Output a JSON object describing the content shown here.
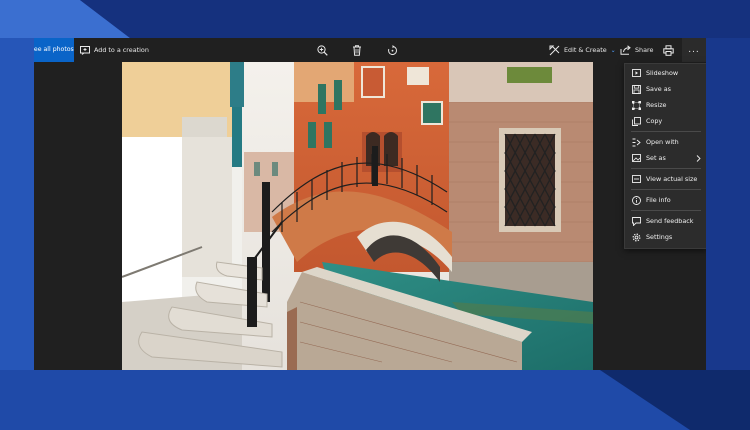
{
  "toolbar": {
    "see_all_label": "See all photos",
    "add_creation_label": "Add to a creation",
    "edit_create_label": "Edit & Create",
    "share_label": "Share",
    "more_label": "..."
  },
  "menu": {
    "items": [
      {
        "label": "Slideshow",
        "icon": "slideshow-icon"
      },
      {
        "label": "Save as",
        "icon": "save-icon"
      },
      {
        "label": "Resize",
        "icon": "resize-icon"
      },
      {
        "label": "Copy",
        "icon": "copy-icon"
      },
      {
        "label": "Open with",
        "icon": "open-with-icon"
      },
      {
        "label": "Set as",
        "icon": "set-as-icon"
      },
      {
        "label": "View actual size",
        "icon": "actual-size-icon"
      },
      {
        "label": "File info",
        "icon": "info-icon"
      },
      {
        "label": "Send feedback",
        "icon": "feedback-icon"
      },
      {
        "label": "Settings",
        "icon": "gear-icon"
      }
    ]
  },
  "colors": {
    "accent": "#0a64c8",
    "window_bg": "#202020",
    "menu_bg": "#2c2c2c",
    "desktop_bg": "#17398a"
  }
}
